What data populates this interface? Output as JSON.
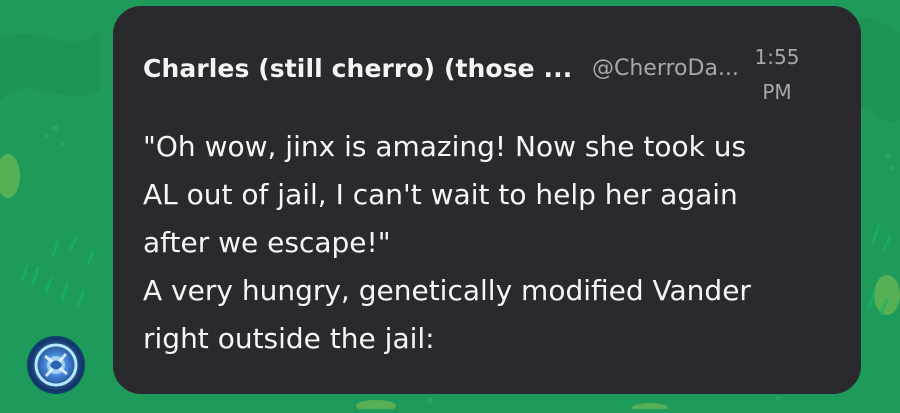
{
  "colors": {
    "background": "#1f9a5b",
    "bubble": "#2a292e",
    "name_text": "#f4f4f4",
    "meta_text": "#a8a7ad",
    "body_text": "#f6f6f6"
  },
  "post": {
    "author": "Charles (still cherro) (those ...",
    "handle": "@CherroDa...",
    "time": "1:55",
    "meridiem": "PM",
    "lines": [
      "\"Oh wow, jinx is amazing! Now she took us",
      "AL out of jail, I can't wait to help her again",
      "after we escape!\"",
      "A very hungry, genetically modified Vander",
      "right outside the jail:"
    ]
  },
  "avatar": {
    "icon": "user-avatar-icon"
  }
}
